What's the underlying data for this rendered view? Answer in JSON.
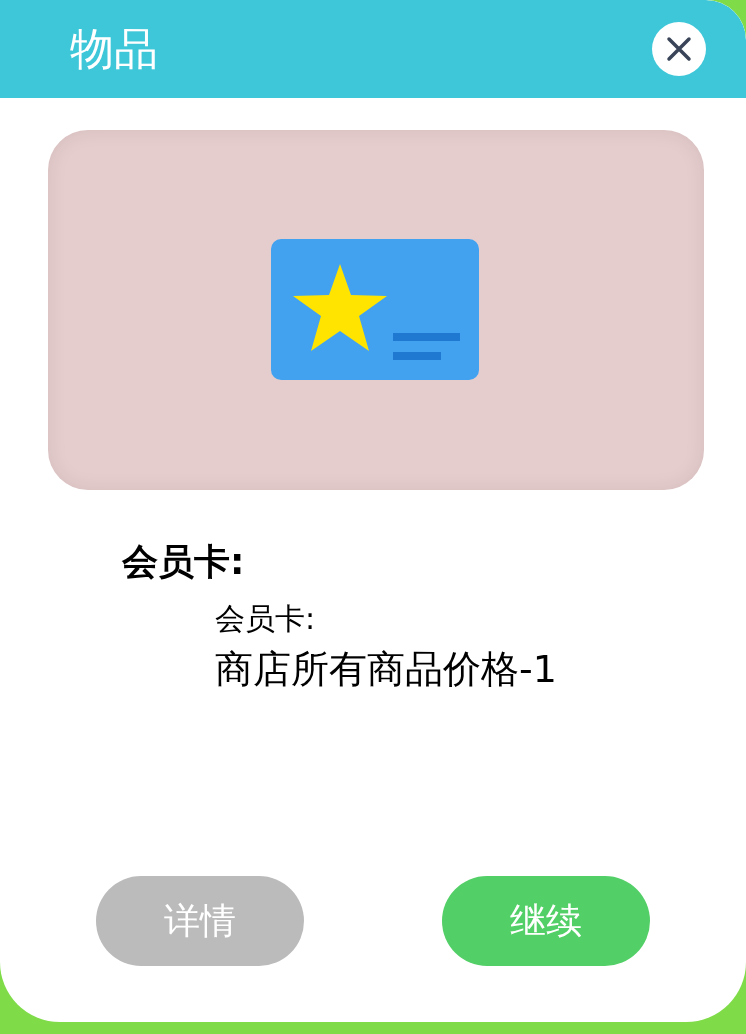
{
  "window": {
    "title": "物品"
  },
  "item": {
    "kind": "picture",
    "name": "会员卡:",
    "subtitle": "会员卡:",
    "description": "商店所有商品价格-1"
  },
  "buttons": [
    {
      "label": "详情",
      "kind": "secondary"
    },
    {
      "label": "继续",
      "kind": "primary"
    }
  ]
}
